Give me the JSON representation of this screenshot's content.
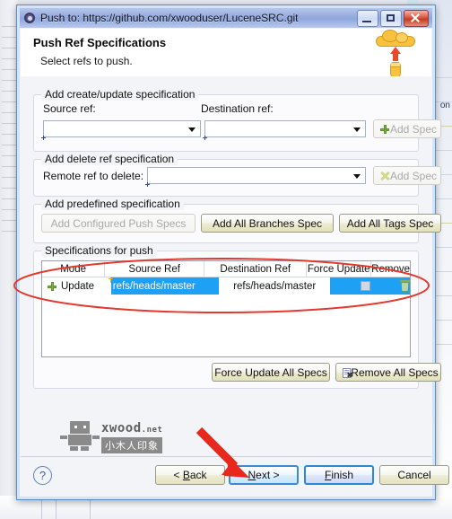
{
  "window": {
    "title": "Push to: https://github.com/xwooduser/LuceneSRC.git",
    "icon": "app-gear-icon",
    "minimize_label": "minimize-icon",
    "maximize_label": "maximize-icon",
    "close_label": "close-icon"
  },
  "header": {
    "title": "Push Ref Specifications",
    "subtitle": "Select refs to push.",
    "icon": "push-cloud-icon"
  },
  "groups": {
    "create": {
      "legend": "Add create/update specification",
      "source_label": "Source ref:",
      "source_value": "",
      "destination_label": "Destination ref:",
      "destination_value": "",
      "add_spec_label": "Add Spec",
      "add_spec_icon": "green-plus-icon"
    },
    "delete": {
      "legend": "Add delete ref specification",
      "remote_label": "Remote ref to delete:",
      "remote_value": "",
      "add_spec_label": "Add Spec",
      "add_spec_icon": "green-x-icon"
    },
    "predefined": {
      "legend": "Add predefined specification",
      "configured_label": "Add Configured Push Specs",
      "branches_label": "Add All Branches Spec",
      "tags_label": "Add All Tags Spec"
    },
    "specs": {
      "legend": "Specifications for push",
      "columns": [
        "Mode",
        "Source Ref",
        "Destination Ref",
        "Force Update",
        "Remove"
      ],
      "rows": [
        {
          "mode_icon": "green-plus-icon",
          "mode": "Update",
          "source_ref": "refs/heads/master",
          "destination_ref": "refs/heads/master",
          "force_update_checked": false,
          "remove_icon": "trash-icon"
        }
      ],
      "force_update_all_label": "Force Update All Specs",
      "remove_all_label": "Remove All Specs",
      "remove_all_icon": "document-delete-icon"
    }
  },
  "watermark": {
    "brand": "xwood",
    "tld": ".net",
    "chinese": "小木人印象",
    "icon": "robot-icon"
  },
  "footer": {
    "help_label": "?",
    "back_label": "< Back",
    "next_label": "Next >",
    "finish_label": "Finish",
    "cancel_label": "Cancel"
  },
  "annotations": {
    "ellipse_color": "#e2392f",
    "arrow_color": "#e8281c",
    "ellipse_target": "specs-table-row",
    "arrow_target": "next-button"
  },
  "colors": {
    "selection_blue": "#1ea0f5",
    "title_bar": "#94aade",
    "accent_yellow": "#f7c33e",
    "red": "#e2392f"
  },
  "background": {
    "editor_hint": "on"
  }
}
